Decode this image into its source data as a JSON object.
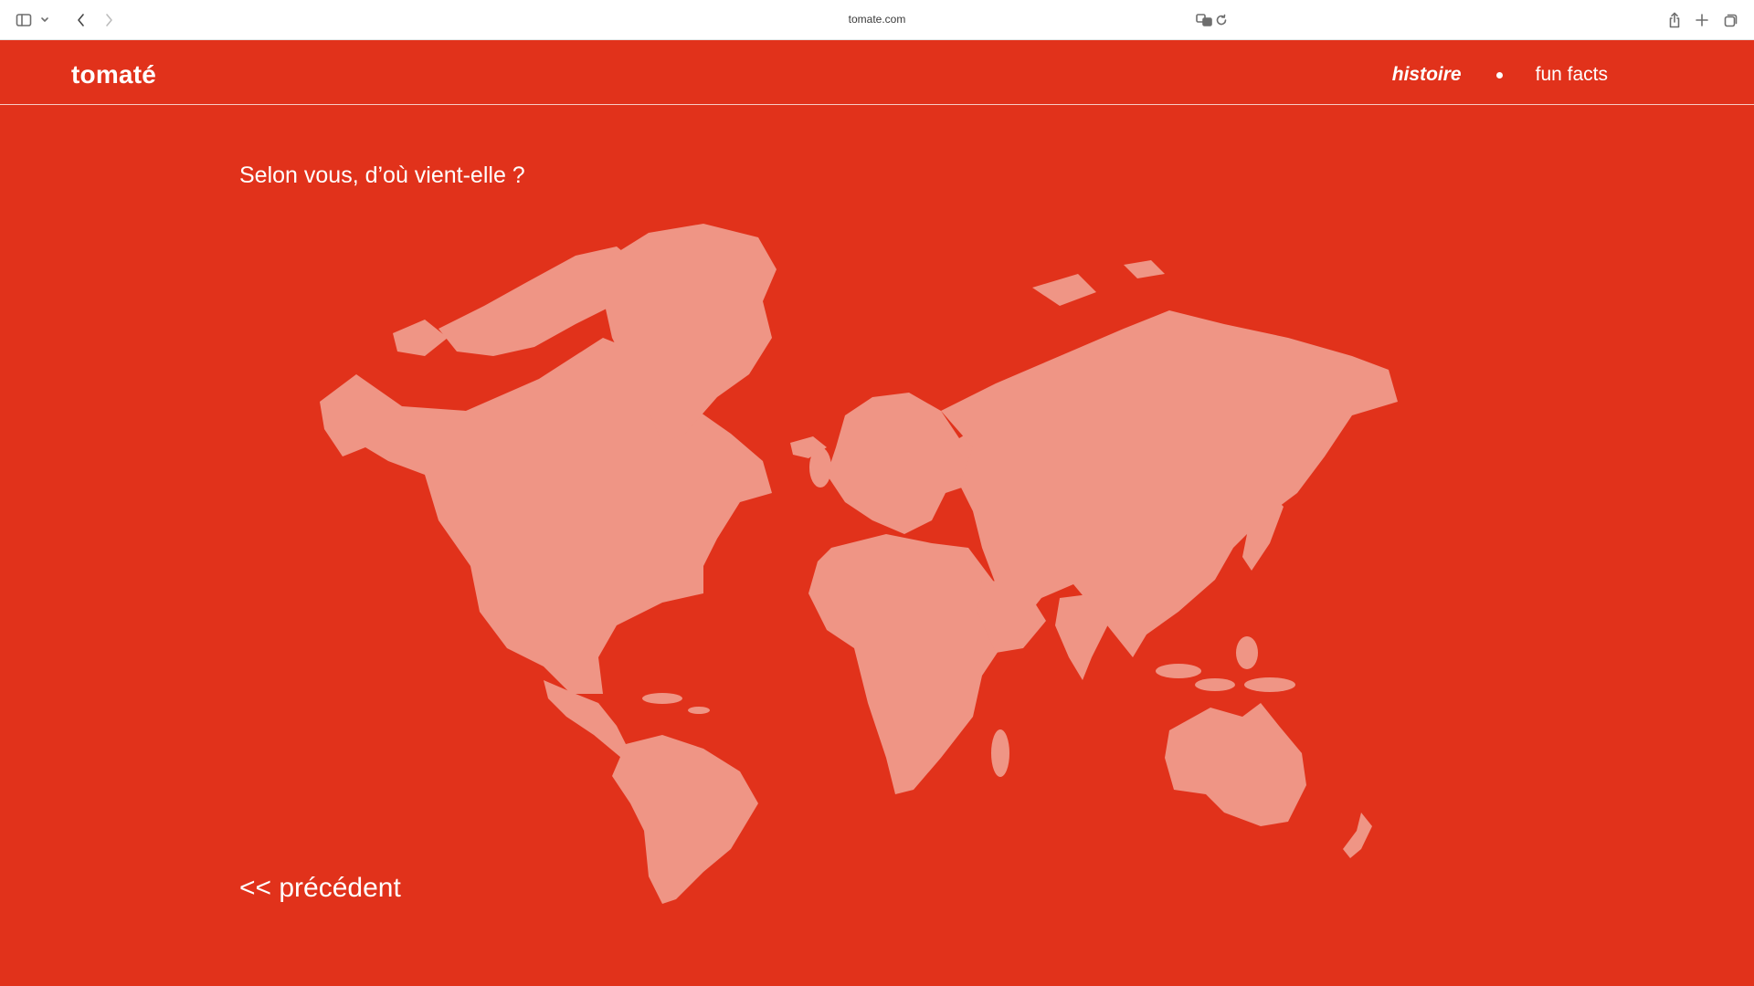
{
  "browser": {
    "url": "tomate.com"
  },
  "site": {
    "logo": "tomaté",
    "nav": {
      "items": [
        {
          "label": "histoire",
          "active": true
        },
        {
          "label": "fun facts",
          "active": false
        }
      ]
    }
  },
  "main": {
    "question": "Selon vous, d’où vient-elle ?",
    "prev_label": "<< précédent"
  },
  "colors": {
    "background": "#e1321b",
    "land": "#ef9585",
    "text": "#ffffff"
  },
  "icons": {
    "sidebar": "sidebar-icon",
    "back": "chevron-left-icon",
    "forward": "chevron-right-icon",
    "translate": "translate-icon",
    "reload": "reload-icon",
    "share": "share-icon",
    "new_tab": "plus-icon",
    "tabs": "tabs-overview-icon"
  }
}
